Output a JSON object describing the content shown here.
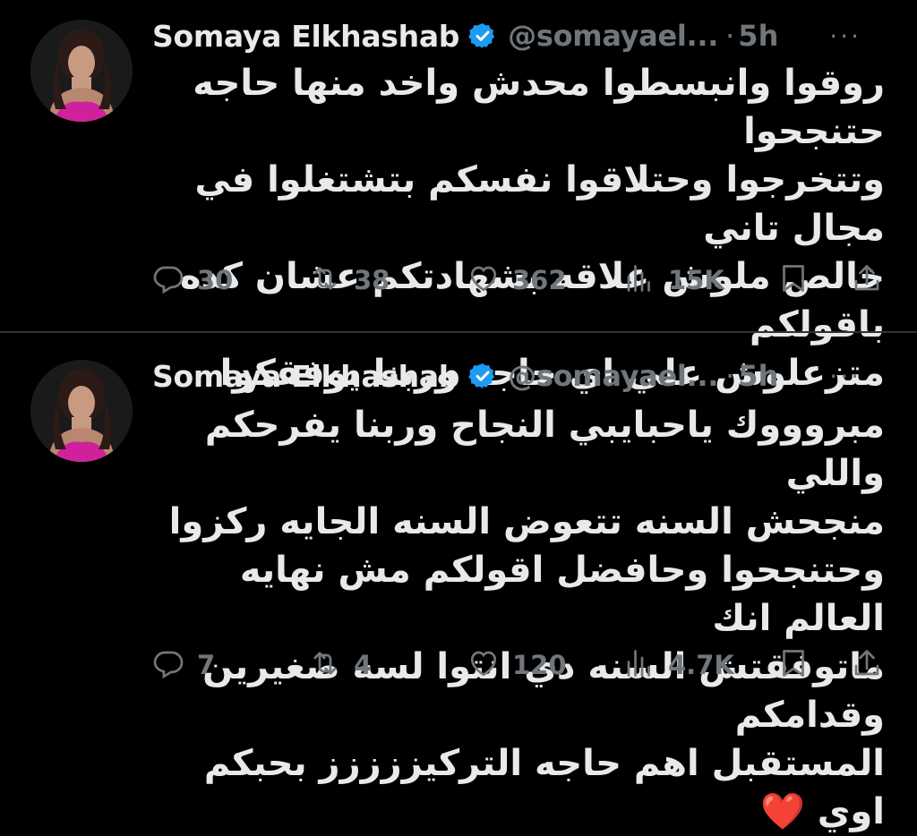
{
  "tweets": [
    {
      "author": "Somaya Elkhashab",
      "handle": "@somayael...",
      "separator": "·",
      "time": "5h",
      "more": "···",
      "lines": [
        "روقوا وانبسطوا محدش واخد منها حاجه حتنجحوا",
        "وتتخرجوا وحتلاقوا نفسكم بتشتغلوا في مجال تاني",
        "خالص ملوش علاقه بشهادتكم عشان كده باقولكم",
        "متزعلوش علي اي حاجه وربنا يوفقكوا"
      ],
      "replies": "30",
      "reposts": "38",
      "likes": "362",
      "views": "15K"
    },
    {
      "author": "Somaya Elkhashab",
      "handle": "@somayael...",
      "separator": "·",
      "time": "5h",
      "more": "···",
      "lines": [
        "مبروووك ياحبايبي النجاح وربنا يفرحكم واللي",
        "منجحش السنه تتعوض السنه الجايه ركزوا",
        "وحتنجحوا وحافضل اقولكم مش نهايه العالم انك",
        "ماتوفقتش السنه دي انتوا لسه صغيرين وقدامكم",
        "المستقبل اهم حاجه التركيززززز بحبكم اوي ❤️"
      ],
      "replies": "7",
      "reposts": "4",
      "likes": "120",
      "views": "4.7K"
    }
  ],
  "colors": {
    "background": "#000000",
    "text": "#e7e9ea",
    "muted": "#71767b",
    "verified": "#1d9bf0",
    "divider": "#2f3336"
  },
  "icons": [
    "verified-badge-icon",
    "reply-icon",
    "repost-icon",
    "like-icon",
    "views-icon",
    "bookmark-icon",
    "share-icon",
    "more-icon"
  ]
}
